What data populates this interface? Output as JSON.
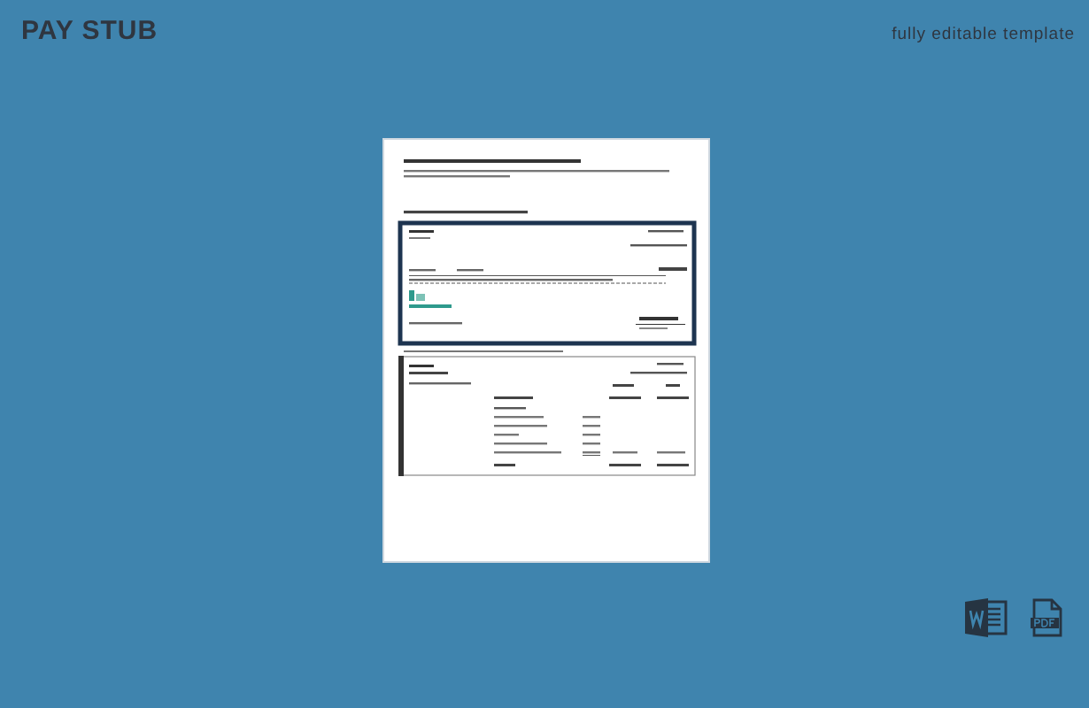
{
  "header": {
    "title": "PAY STUB",
    "tagline": "fully editable template"
  }
}
